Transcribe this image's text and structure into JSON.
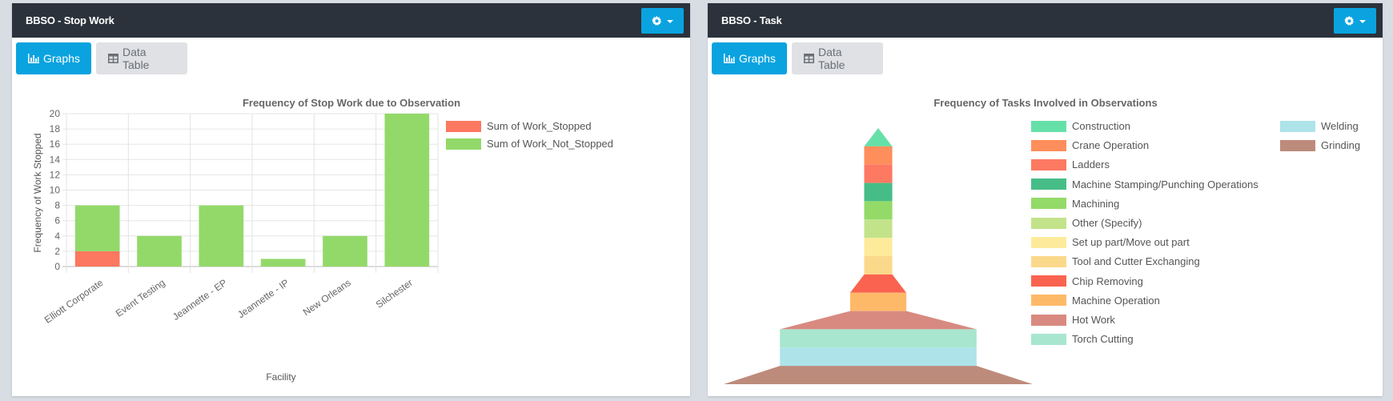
{
  "panels": [
    {
      "title": "BBSO - Stop Work",
      "settings_icon": "gear-icon",
      "tabs": [
        {
          "label": "Graphs",
          "icon": "bar-chart-icon",
          "active": true
        },
        {
          "label": "Data Table",
          "icon": "table-icon",
          "active": false
        }
      ]
    },
    {
      "title": "BBSO - Task",
      "settings_icon": "gear-icon",
      "tabs": [
        {
          "label": "Graphs",
          "icon": "bar-chart-icon",
          "active": true
        },
        {
          "label": "Data Table",
          "icon": "table-icon",
          "active": false
        }
      ]
    }
  ],
  "colors": {
    "header_bg": "#2b323b",
    "accent": "#0aa3e0"
  },
  "chart_data": [
    {
      "type": "bar",
      "stacked": true,
      "title": "Frequency of Stop Work due to Observation",
      "xlabel": "Facility",
      "ylabel": "Frequency of Work Stopped",
      "ylim": [
        0,
        20
      ],
      "yticks": [
        "0",
        "2",
        "4",
        "6",
        "8",
        "10",
        "12",
        "14",
        "16",
        "18",
        "20"
      ],
      "grid": true,
      "legend_position": "right",
      "categories": [
        "Elliott Corporate",
        "Event Testing",
        "Jeannette - EP",
        "Jeannette - IP",
        "New Orleans",
        "Silchester"
      ],
      "series": [
        {
          "name": "Sum of Work_Stopped",
          "color": "#fc7860",
          "values": [
            2,
            0,
            0,
            0,
            0,
            0
          ]
        },
        {
          "name": "Sum of Work_Not_Stopped",
          "color": "#93d96a",
          "values": [
            6,
            4,
            8,
            1,
            4,
            20
          ]
        }
      ]
    },
    {
      "type": "funnel",
      "title": "Frequency of Tasks Involved in Observations",
      "legend_position": "right",
      "note": "Segments ordered smallest (top) to largest (bottom); values estimated from segment widths, relative scale",
      "segments": [
        {
          "name": "Construction",
          "color": "#66e0a9",
          "value": 1
        },
        {
          "name": "Crane Operation",
          "color": "#fe8e5c",
          "value": 1
        },
        {
          "name": "Ladders",
          "color": "#fd7962",
          "value": 1
        },
        {
          "name": "Machine Stamping/Punching Operations",
          "color": "#46bd87",
          "value": 1
        },
        {
          "name": "Machining",
          "color": "#93da68",
          "value": 1
        },
        {
          "name": "Other (Specify)",
          "color": "#c2e38a",
          "value": 1
        },
        {
          "name": "Set up part/Move out part",
          "color": "#fdeb9b",
          "value": 1
        },
        {
          "name": "Tool and Cutter Exchanging",
          "color": "#fbd98b",
          "value": 1
        },
        {
          "name": "Chip Removing",
          "color": "#fa634f",
          "value": 2
        },
        {
          "name": "Machine Operation",
          "color": "#feb968",
          "value": 2
        },
        {
          "name": "Hot Work",
          "color": "#d88a80",
          "value": 7
        },
        {
          "name": "Torch Cutting",
          "color": "#a8e6cf",
          "value": 7
        },
        {
          "name": "Welding",
          "color": "#aee3ea",
          "value": 7
        },
        {
          "name": "Grinding",
          "color": "#bd8b7b",
          "value": 11
        }
      ]
    }
  ]
}
